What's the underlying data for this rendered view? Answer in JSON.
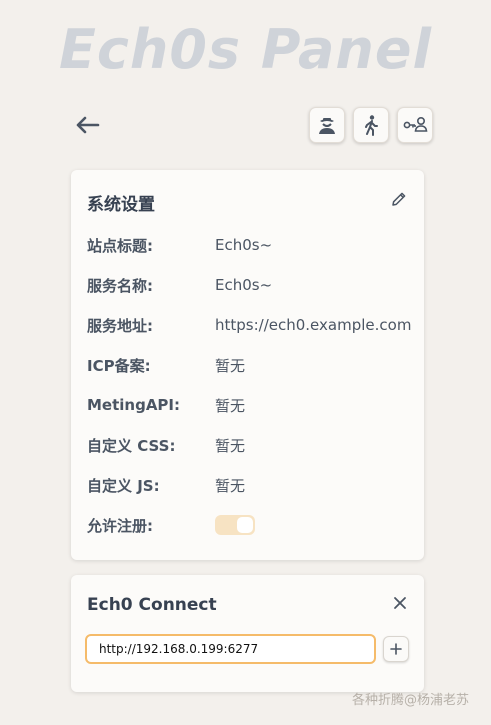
{
  "header": {
    "title": "Ech0s Panel"
  },
  "toolbar": {
    "back_icon": "arrow-left-icon",
    "buttons": [
      {
        "icon": "user-hat-icon"
      },
      {
        "icon": "walking-person-icon"
      },
      {
        "icon": "user-key-icon"
      }
    ]
  },
  "settings": {
    "title": "系统设置",
    "edit_icon": "pencil-icon",
    "rows": [
      {
        "label": "站点标题:",
        "value": "Ech0s~"
      },
      {
        "label": "服务名称:",
        "value": "Ech0s~"
      },
      {
        "label": "服务地址:",
        "value": "https://ech0.example.com"
      },
      {
        "label": "ICP备案:",
        "value": "暂无"
      },
      {
        "label": "MetingAPI:",
        "value": "暂无"
      },
      {
        "label": "自定义 CSS:",
        "value": "暂无"
      },
      {
        "label": "自定义 JS:",
        "value": "暂无"
      }
    ],
    "allow_register": {
      "label": "允许注册:",
      "enabled": true
    }
  },
  "connect": {
    "title": "Ech0 Connect",
    "input_value": "http://192.168.0.199:6277",
    "close_icon": "close-icon",
    "add_icon": "plus-icon"
  },
  "watermark": "各种折腾@杨浦老苏",
  "colors": {
    "background": "#f3f0ec",
    "card": "#fcfbf9",
    "accent": "#f5bb6a",
    "toggle": "#f7e3c3"
  }
}
